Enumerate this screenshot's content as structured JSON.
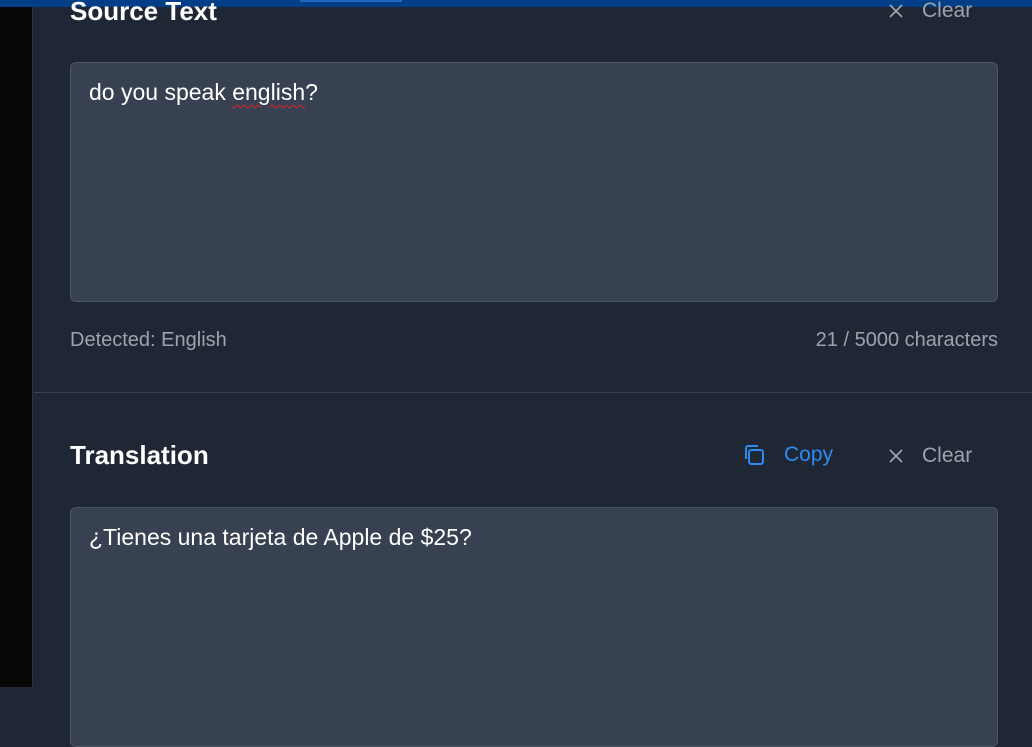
{
  "source": {
    "title": "Source Text",
    "clear_label": "Clear",
    "text_before": "do you speak ",
    "text_misspelled": "english",
    "text_after": "?",
    "detected": "Detected: English",
    "char_count": "21 / 5000 characters"
  },
  "translation": {
    "title": "Translation",
    "copy_label": "Copy",
    "clear_label": "Clear",
    "text": "¿Tienes una tarjeta de Apple de $25?"
  },
  "colors": {
    "accent": "#2d8cf0",
    "panel": "#1f2735",
    "field": "#374151"
  }
}
